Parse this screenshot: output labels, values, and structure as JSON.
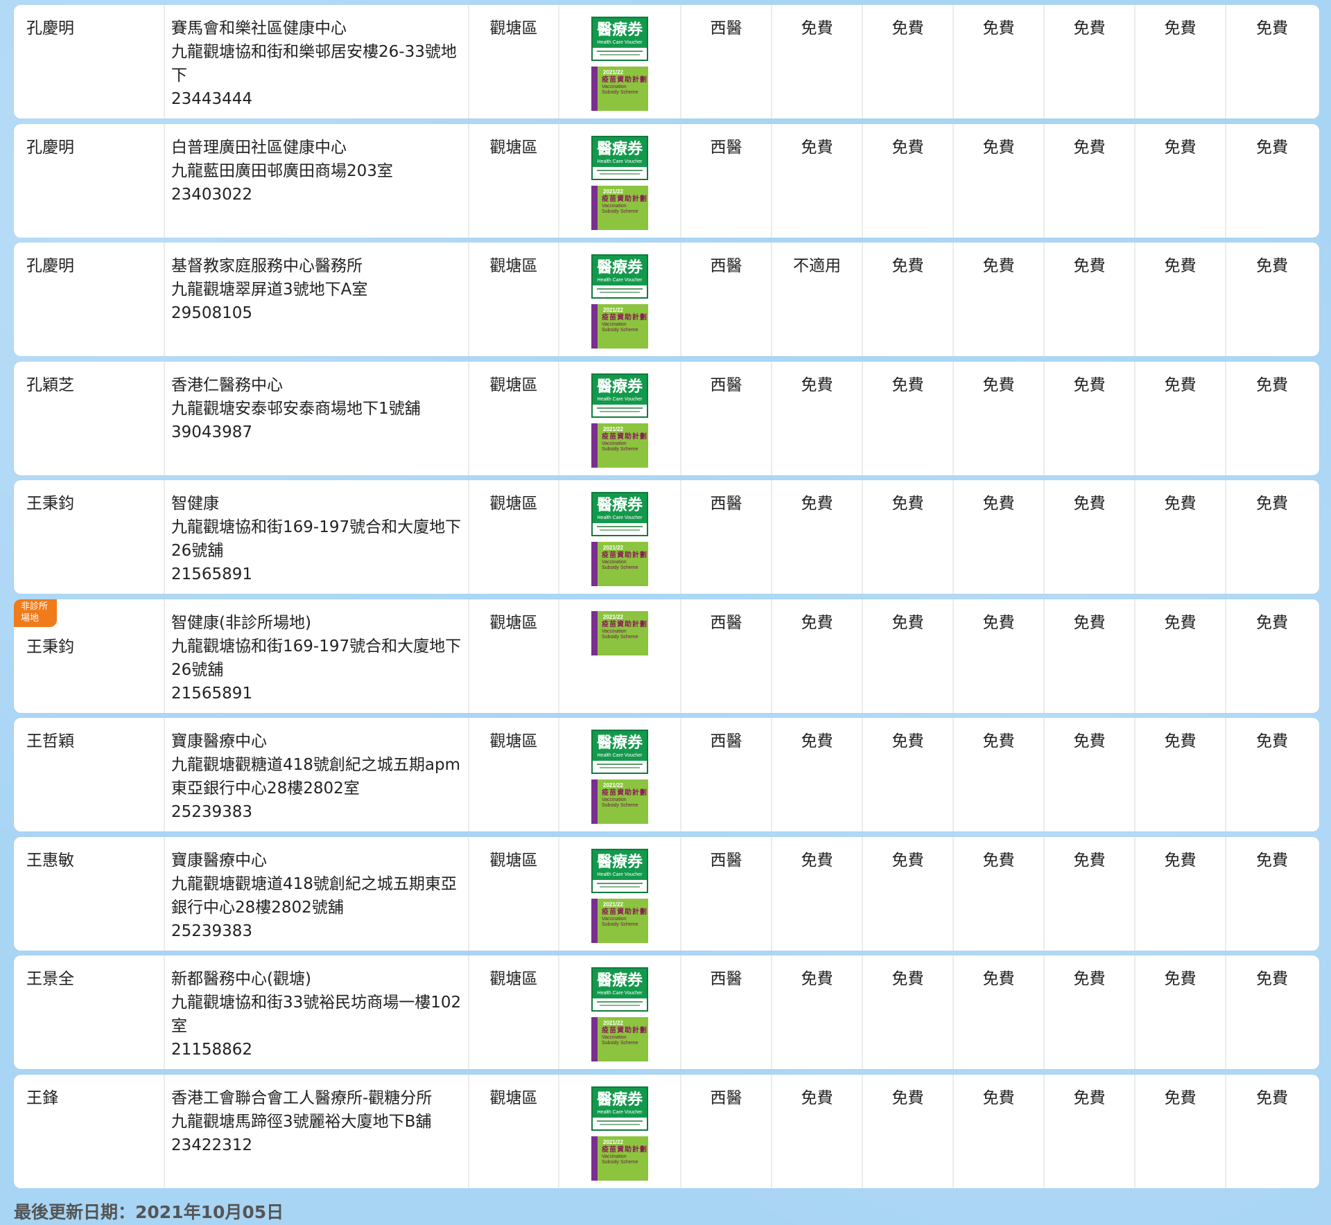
{
  "scheme_logos": {
    "hcv": {
      "cn": "醫療券",
      "en": "Health Care Voucher",
      "color": "#13994c"
    },
    "vss": {
      "year": "2021/22",
      "cn": "疫苗資助計劃",
      "en1": "Vaccination",
      "en2": "Subsidy Scheme",
      "color": "#8cc43f",
      "accent": "#7a2f8f"
    }
  },
  "colors": {
    "background": "#a9d5f5",
    "badge": "#f07b1a"
  },
  "rows": [
    {
      "doctor": "孔慶明",
      "clinic_name": "賽馬會和樂社區健康中心",
      "address": "九龍觀塘協和街和樂邨居安樓26-33號地下",
      "phone": "23443444",
      "district": "觀塘區",
      "type": "西醫",
      "fees": [
        "免費",
        "免費",
        "免費",
        "免費",
        "免費",
        "免費"
      ]
    },
    {
      "doctor": "孔慶明",
      "clinic_name": "白普理廣田社區健康中心",
      "address": "九龍藍田廣田邨廣田商場203室",
      "phone": "23403022",
      "district": "觀塘區",
      "type": "西醫",
      "fees": [
        "免費",
        "免費",
        "免費",
        "免費",
        "免費",
        "免費"
      ]
    },
    {
      "doctor": "孔慶明",
      "clinic_name": "基督教家庭服務中心醫務所",
      "address": "九龍觀塘翠屏道3號地下A室",
      "phone": "29508105",
      "district": "觀塘區",
      "type": "西醫",
      "fees": [
        "不適用",
        "免費",
        "免費",
        "免費",
        "免費",
        "免費"
      ]
    },
    {
      "doctor": "孔穎芝",
      "clinic_name": "香港仁醫務中心",
      "address": "九龍觀塘安泰邨安泰商場地下1號舖",
      "phone": "39043987",
      "district": "觀塘區",
      "type": "西醫",
      "fees": [
        "免費",
        "免費",
        "免費",
        "免費",
        "免費",
        "免費"
      ]
    },
    {
      "doctor": "王秉鈞",
      "clinic_name": "智健康",
      "address": "九龍觀塘協和街169-197號合和大廈地下26號舖",
      "phone": "21565891",
      "district": "觀塘區",
      "type": "西醫",
      "fees": [
        "免費",
        "免費",
        "免費",
        "免費",
        "免費",
        "免費"
      ]
    },
    {
      "badge": "非診所場地",
      "doctor": "王秉鈞",
      "clinic_name": "智健康(非診所場地)",
      "address": "九龍觀塘協和街169-197號合和大廈地下26號舖",
      "phone": "21565891",
      "district": "觀塘區",
      "type": "西醫",
      "fees": [
        "免費",
        "免費",
        "免費",
        "免費",
        "免費",
        "免費"
      ]
    },
    {
      "doctor": "王哲穎",
      "clinic_name": "寶康醫療中心",
      "address": "九龍觀塘觀糖道418號創紀之城五期apm東亞銀行中心28樓2802室",
      "phone": "25239383",
      "district": "觀塘區",
      "type": "西醫",
      "fees": [
        "免費",
        "免費",
        "免費",
        "免費",
        "免費",
        "免費"
      ]
    },
    {
      "doctor": "王惠敏",
      "clinic_name": "寶康醫療中心",
      "address": "九龍觀塘觀塘道418號創紀之城五期東亞銀行中心28樓2802號舖",
      "phone": "25239383",
      "district": "觀塘區",
      "type": "西醫",
      "fees": [
        "免費",
        "免費",
        "免費",
        "免費",
        "免費",
        "免費"
      ]
    },
    {
      "doctor": "王景全",
      "clinic_name": "新都醫務中心(觀塘)",
      "address": "九龍觀塘協和街33號裕民坊商場一樓102室",
      "phone": "21158862",
      "district": "觀塘區",
      "type": "西醫",
      "fees": [
        "免費",
        "免費",
        "免費",
        "免費",
        "免費",
        "免費"
      ]
    },
    {
      "doctor": "王鋒",
      "clinic_name": "香港工會聯合會工人醫療所-觀糖分所",
      "address": "九龍觀塘馬蹄徑3號麗裕大廈地下B舖",
      "phone": "23422312",
      "district": "觀塘區",
      "type": "西醫",
      "fees": [
        "免費",
        "免費",
        "免費",
        "免費",
        "免費",
        "免費"
      ]
    }
  ],
  "footer": {
    "last_updated": "最後更新日期：2021年10月05日"
  }
}
